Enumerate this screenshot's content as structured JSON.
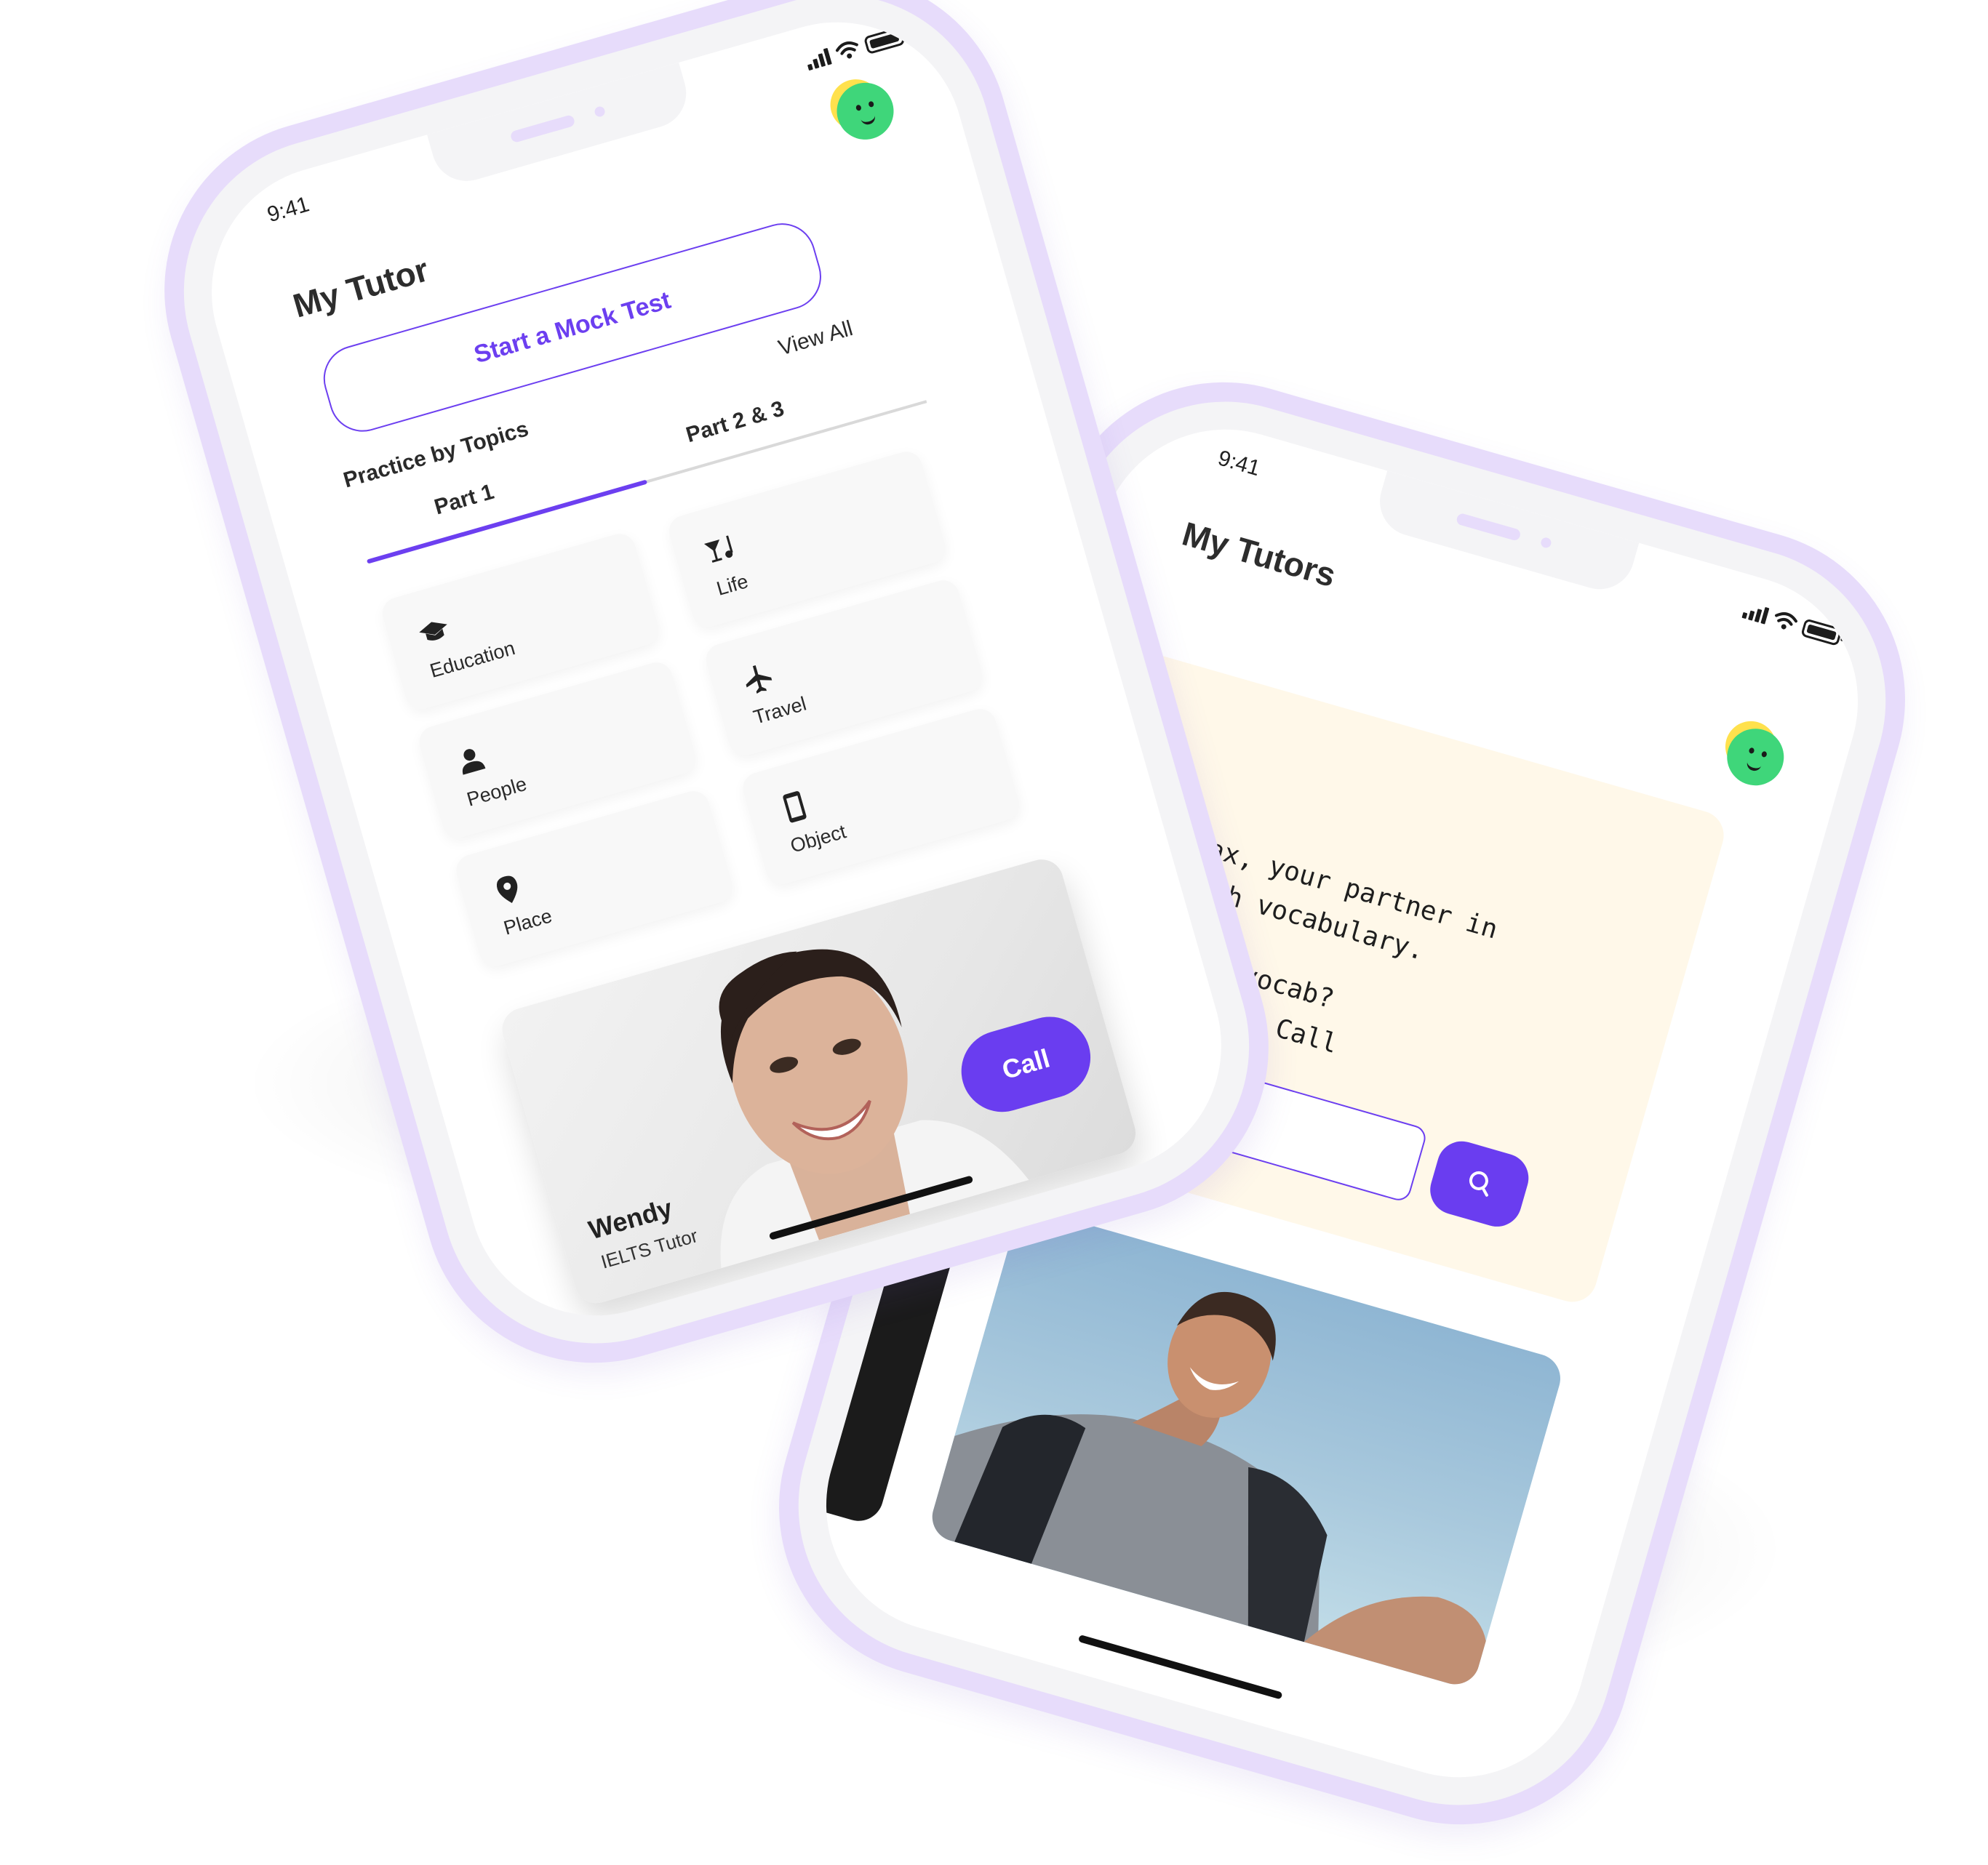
{
  "colors": {
    "accent": "#6c3ff0",
    "phone_frame": "#e7dcfb",
    "chat_bg": "#fff8e9",
    "tile_bg": "#f8f8f8"
  },
  "phone_front": {
    "status_time": "9:41",
    "page_title": "My Tutor",
    "mock_test_label": "Start a Mock Test",
    "view_all_label": "View All",
    "section_title": "Practice by Topics",
    "tabs": [
      {
        "label": "Part 1",
        "active": true
      },
      {
        "label": "Part 2 & 3",
        "active": false
      }
    ],
    "topics": [
      {
        "label": "Education",
        "icon": "graduation-cap-icon"
      },
      {
        "label": "Life",
        "icon": "cocktail-music-icon"
      },
      {
        "label": "People",
        "icon": "person-icon"
      },
      {
        "label": "Travel",
        "icon": "airplane-icon"
      },
      {
        "label": "Place",
        "icon": "location-pin-icon"
      },
      {
        "label": "Object",
        "icon": "phone-device-icon"
      }
    ],
    "tutor": {
      "name": "Wendy",
      "role": "IELTS Tutor",
      "call_label": "Call"
    }
  },
  "phone_back": {
    "status_time": "9:41",
    "page_title": "My Tutors",
    "chat_lines": [
      "Hey! 👋 I'm Max, your partner in",
      "astering English vocabulary.",
      "o enhance your vocab?",
      "ne below or click Call"
    ],
    "search_icon": "search-icon"
  }
}
